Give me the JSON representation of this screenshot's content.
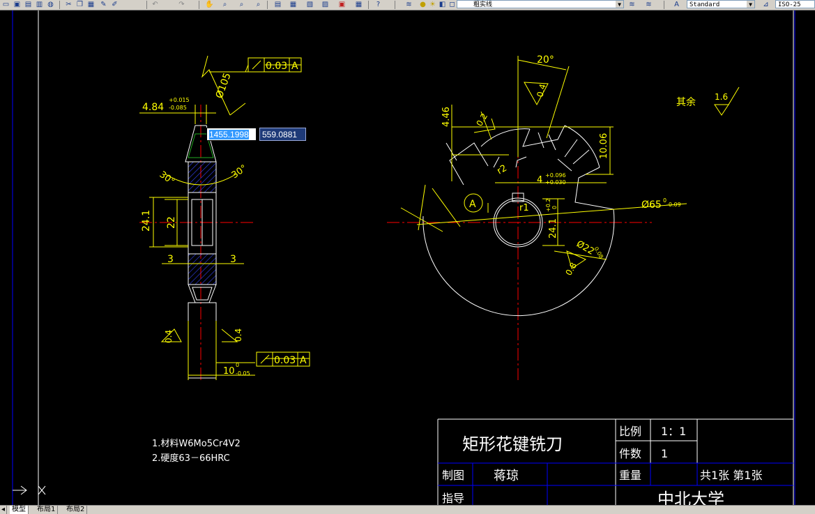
{
  "toolbar": {
    "layer_name": "粗实线",
    "text_style": "Standard",
    "dim_style": "ISO-25"
  },
  "coord_input": {
    "x": "1455.1998",
    "y": "559.0881"
  },
  "dims": {
    "side_width_top": "4.84",
    "side_width_top_tol_up": "+0.015",
    "side_width_top_tol_low": "-0.085",
    "diam105": "Ø105",
    "runout1": "0.03",
    "datum1": "A",
    "angle_left": "30°",
    "angle_right": "30°",
    "h241": "24.1",
    "h22": "22",
    "w3_left": "3",
    "w3_right": "3",
    "rough04_left": "0.4",
    "rough04_right": "0.4",
    "runout2": "0.03",
    "datum2": "A",
    "width10": "10",
    "width10_tol_up": "0",
    "width10_tol_low": "-0.05",
    "angle20": "20°",
    "rough04_top": "0.4",
    "rough02": "0.2",
    "d446": "4.46",
    "d1006": "10.06",
    "r2": "r2",
    "key4": "4",
    "key4_tol_up": "+0.096",
    "key4_tol_low": "+0.030",
    "d65": "Ø65",
    "d65_tol_up": "0",
    "d65_tol_low": "-0.09",
    "r1": "r1",
    "circle_label": "A",
    "d241": "24.1",
    "d241_tol_up": "+0.2",
    "d241_tol_low": "0",
    "d22": "Ø22",
    "d22_tol": "0.08",
    "rough08": "0.8",
    "rough_other_label": "其余",
    "rough_other_val": "1.6"
  },
  "notes": {
    "line1": "1.材料W6Mo5Cr4V2",
    "line2": "2.硬度63－66HRC"
  },
  "title_block": {
    "part_name": "矩形花键铣刀",
    "scale_label": "比例",
    "scale_value": "1：1",
    "qty_label": "件数",
    "qty_value": "1",
    "drawn_label": "制图",
    "drawn_by": "蒋琼",
    "weight_label": "重量",
    "sheet_info": "共1张 第1张",
    "guide_label": "指导",
    "school": "中北大学"
  },
  "tabs": [
    "模型",
    "布局1",
    "布局2"
  ],
  "colors": {
    "background": "#000000",
    "outline": "#ffffff",
    "dimension": "#ffff00",
    "centerline": "#ff0000",
    "hatch": "#3344ff",
    "frame": "#0000ff"
  }
}
